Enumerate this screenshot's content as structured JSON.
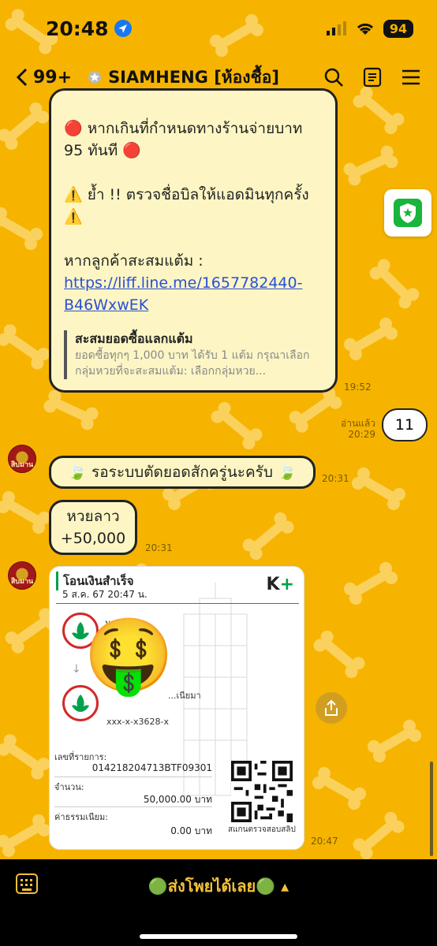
{
  "status_bar": {
    "time": "20:48",
    "battery": "94"
  },
  "header": {
    "back_count": "99+",
    "chat_title": "SIAMHENG [ห้องชื้อ]"
  },
  "messages": {
    "big": {
      "line1": "🔴 หากเกินที่กำหนดทางร้านจ่ายบาท 95 ทันที 🔴",
      "line2": "⚠️ ย้ำ !! ตรวจชื่อบิลให้แอดมินทุกครั้ง ⚠️",
      "line3_prefix": "หากลูกค้าสะสมแต้ม : ",
      "link": "https://liff.line.me/1657782440-B46WxwEK",
      "quote_title": "สะสมยอดซื้อแลกแต้ม",
      "quote_text": "ยอดซื้อทุกๆ 1,000 บาท ได้รับ 1 แต้ม กรุณาเลือกกลุ่มหวยที่จะสะสมแต้ม: เลือกกลุ่มหวย...",
      "time": "19:52"
    },
    "mine": {
      "read_label": "อ่านแล้ว",
      "time": "20:29",
      "text": "11"
    },
    "sticker": {
      "text": "🍃 รอระบบตัดยอดสักครู่นะครับ 🍃",
      "time": "20:31"
    },
    "lao": {
      "line1": "หวยลาว",
      "line2": "+50,000",
      "time": "20:31"
    },
    "slip": {
      "title": "โอนเงินสำเร็จ",
      "date": "5 ส.ค. 67  20:47 น.",
      "bank_logo_k": "K",
      "bank_logo_plus": "+",
      "from_name": "นาย...อ",
      "to_name": "...เนียมา",
      "to_account": "xxx-x-x3628-x",
      "ref_label": "เลขที่รายการ:",
      "ref_value": "014218204713BTF09301",
      "amount_label": "จำนวน:",
      "amount_value": "50,000.00 บาท",
      "fee_label": "ค่าธรรมเนียม:",
      "fee_value": "0.00 บาท",
      "qr_caption": "สแกนตรวจสอบสลิป",
      "time": "20:47"
    },
    "emoji": "🤑"
  },
  "avatar_label": "สิบมาน",
  "bottom_menu": {
    "label": "🟢ส่งโพยได้เลย🟢 ▴"
  },
  "colors": {
    "background": "#f6b400",
    "bubble": "#fdf6c4",
    "link": "#2a4fd6",
    "kbank_green": "#00a14b"
  }
}
